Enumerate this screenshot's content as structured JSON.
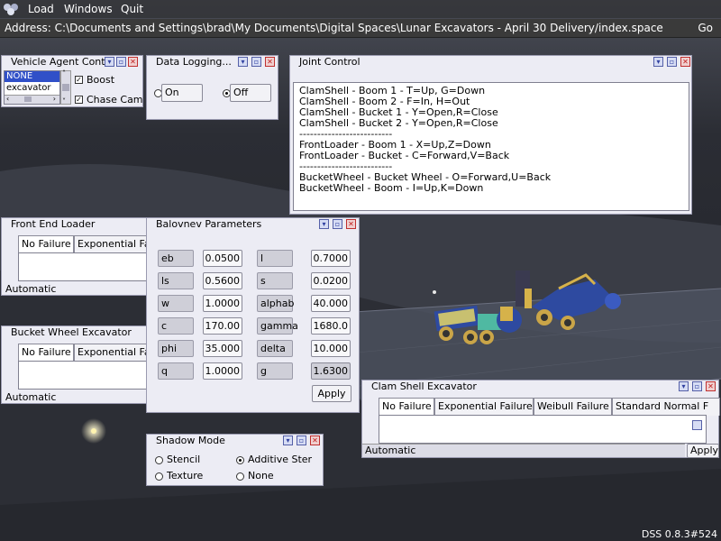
{
  "menubar": {
    "items": [
      "Load",
      "Windows",
      "Quit"
    ]
  },
  "address": {
    "label": "Address:",
    "value": "C:\\Documents and Settings\\brad\\My Documents\\Digital Spaces\\Lunar Excavators - April 30 Delivery/index.space",
    "go_label": "Go"
  },
  "vehicle_agent": {
    "title": "Vehicle Agent Contr",
    "list": [
      "NONE",
      "excavator"
    ],
    "boost_label": "Boost",
    "chase_cam_label": "Chase Cam"
  },
  "data_logging": {
    "title": "Data Logging...",
    "on_label": "On",
    "off_label": "Off",
    "selected": "Off"
  },
  "joint_control": {
    "title": "Joint Control",
    "lines": [
      "ClamShell - Boom 1 - T=Up, G=Down",
      "ClamShell - Boom 2 - F=In, H=Out",
      "ClamShell - Bucket 1 - Y=Open,R=Close",
      "ClamShell - Bucket 2 - Y=Open,R=Close",
      "--------------------------",
      "FrontLoader - Boom 1 - X=Up,Z=Down",
      "FrontLoader - Bucket - C=Forward,V=Back",
      "--------------------------",
      "BucketWheel - Bucket Wheel - O=Forward,U=Back",
      "BucketWheel - Boom - I=Up,K=Down"
    ]
  },
  "front_end_loader": {
    "title": "Front End Loader",
    "tabs": [
      "No Failure",
      "Exponential Fa"
    ],
    "status": "Automatic"
  },
  "bucket_wheel": {
    "title": "Bucket Wheel Excavator",
    "tabs": [
      "No Failure",
      "Exponential Fa"
    ],
    "status": "Automatic"
  },
  "balovnev": {
    "title": "Balovnev Parameters",
    "apply_label": "Apply",
    "params": [
      {
        "label": "eb",
        "value": "0.0500"
      },
      {
        "label": "l",
        "value": "0.7000"
      },
      {
        "label": "ls",
        "value": "0.5600"
      },
      {
        "label": "s",
        "value": "0.0200"
      },
      {
        "label": "w",
        "value": "1.0000"
      },
      {
        "label": "alphab",
        "value": "40.000"
      },
      {
        "label": "c",
        "value": "170.00"
      },
      {
        "label": "gamma",
        "value": "1680.0"
      },
      {
        "label": "phi",
        "value": "35.000"
      },
      {
        "label": "delta",
        "value": "10.000"
      },
      {
        "label": "q",
        "value": "1.0000"
      },
      {
        "label": "g",
        "value": "1.6300"
      }
    ]
  },
  "shadow_mode": {
    "title": "Shadow Mode",
    "options": [
      "Stencil",
      "Additive Ster",
      "Texture",
      "None"
    ],
    "selected": "Additive Ster"
  },
  "clam_shell": {
    "title": "Clam Shell Excavator",
    "tabs": [
      "No Failure",
      "Exponential Failure",
      "Weibull Failure",
      "Standard Normal F"
    ],
    "status": "Automatic",
    "apply_label": "Apply"
  },
  "version": "DSS 0.8.3#524"
}
